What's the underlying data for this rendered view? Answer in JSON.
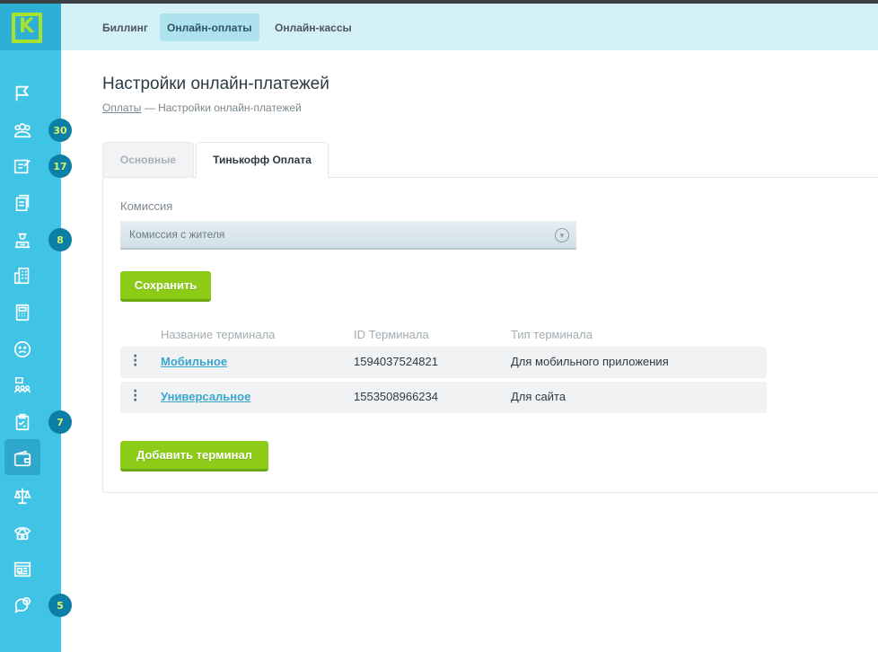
{
  "app": {
    "logo_letter": "K",
    "accent": "#3fc4e6",
    "button_color": "#8ccc18"
  },
  "topnav": {
    "tabs": [
      {
        "label": "Биллинг",
        "active": false
      },
      {
        "label": "Онлайн-оплаты",
        "active": true
      },
      {
        "label": "Онлайн-кассы",
        "active": false
      }
    ]
  },
  "sidebar": {
    "items": [
      {
        "icon": "flag-icon"
      },
      {
        "icon": "people-icon",
        "badge": "30"
      },
      {
        "icon": "edit-note-icon",
        "badge": "17"
      },
      {
        "icon": "documents-icon"
      },
      {
        "icon": "worker-icon",
        "badge": "8"
      },
      {
        "icon": "building-icon"
      },
      {
        "icon": "calculator-icon"
      },
      {
        "icon": "sad-face-icon"
      },
      {
        "icon": "meeting-icon"
      },
      {
        "icon": "checklist-icon",
        "badge": "7"
      },
      {
        "icon": "wallet-icon",
        "active": true
      },
      {
        "icon": "scales-icon"
      },
      {
        "icon": "phone-icon"
      },
      {
        "icon": "news-icon"
      },
      {
        "icon": "chat-add-icon",
        "badge": "5"
      }
    ]
  },
  "page": {
    "title": "Настройки онлайн-платежей",
    "breadcrumb": {
      "link": "Оплаты",
      "separator": "—",
      "current": "Настройки онлайн-платежей"
    }
  },
  "tabs": [
    {
      "label": "Основные",
      "active": false
    },
    {
      "label": "Тинькофф Оплата",
      "active": true
    }
  ],
  "form": {
    "commission_label": "Комиссия",
    "commission_value": "Комиссия с жителя",
    "save_label": "Сохранить"
  },
  "table": {
    "headers": [
      "Название терминала",
      "ID Терминала",
      "Тип терминала"
    ],
    "rows": [
      {
        "name": "Мобильное",
        "id": "1594037524821",
        "type": "Для мобильного приложения"
      },
      {
        "name": "Универсальное",
        "id": "1553508966234",
        "type": "Для сайта"
      }
    ]
  },
  "add_terminal_label": "Добавить терминал"
}
